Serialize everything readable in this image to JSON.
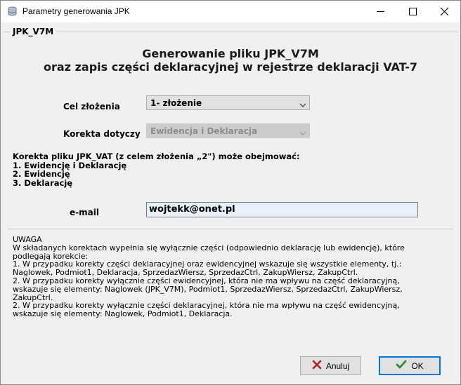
{
  "window": {
    "title": "Parametry generowania JPK"
  },
  "group": {
    "title": "JPK_V7M"
  },
  "heading": {
    "line1": "Generowanie pliku JPK_V7M",
    "line2": "oraz zapis części deklaracyjnej w rejestrze deklaracji VAT-7"
  },
  "form": {
    "cel_label": "Cel złożenia",
    "cel_value": "1- złożenie",
    "korekta_label": "Korekta dotyczy",
    "korekta_value": "Ewidencja i Deklaracja",
    "email_label": "e-mail",
    "email_value": "wojtekk@onet.pl"
  },
  "korekta_info": [
    "Korekta pliku JPK_VAT (z celem złożenia „2\") może obejmować:",
    "1. Ewidencję i Deklarację",
    "2. Ewidencję",
    "3. Deklarację"
  ],
  "uwaga": [
    "UWAGA",
    "W składanych korektach wypełnia się wyłącznie części (odpowiednio deklarację lub ewidencję), które",
    "podlegają korekcie:",
    "1. W przypadku korekty części deklaracyjnej oraz ewidencyjnej wskazuje się wszystkie elementy, tj.:",
    "Naglowek, Podmiot1, Deklaracja, SprzedazWiersz, SprzedazCtrl, ZakupWiersz, ZakupCtrl.",
    "2. W przypadku korekty wyłącznie części ewidencyjnej, która nie ma wpływu na część deklaracyjną,",
    "wskazuje się elementy: Naglowek (JPK_V7M), Podmiot1, SprzedazWiersz, SprzedazCtrl, ZakupWiersz,",
    "ZakupCtrl.",
    "2. W przypadku korekty wyłącznie części deklaracyjnej, która nie ma wpływu na część ewidencyjną,",
    "wskazuje się elementy: Naglowek, Podmiot1, Deklaracja."
  ],
  "buttons": {
    "cancel_label": "Anuluj",
    "ok_label": "OK"
  },
  "colors": {
    "cancel_icon": "#b22222",
    "ok_icon": "#2e8b2e",
    "focus_border": "#0078d7"
  }
}
